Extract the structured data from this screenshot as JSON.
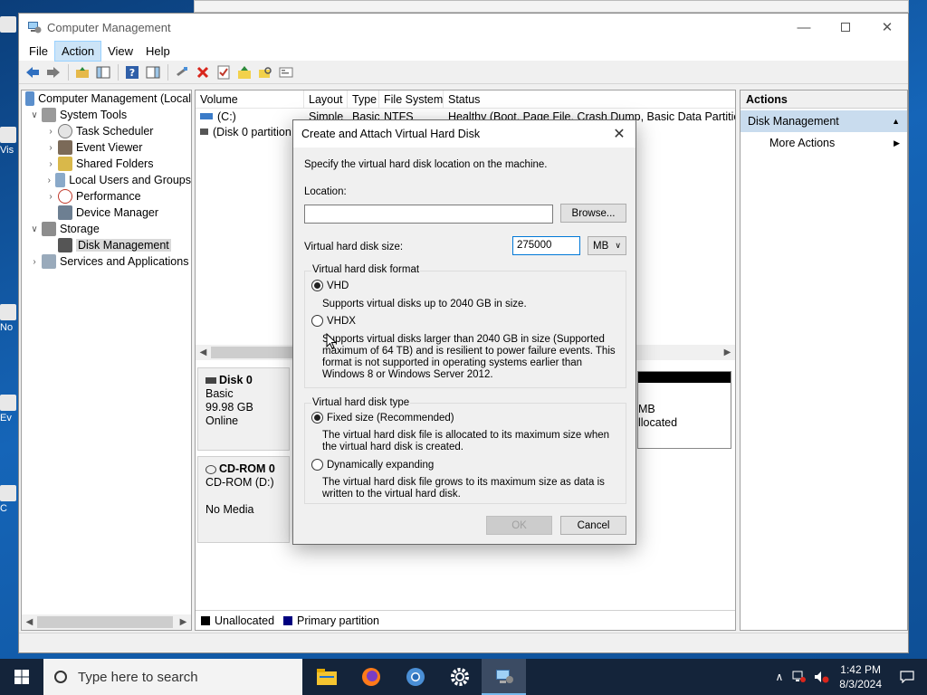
{
  "desktop": {
    "icon_labels": [
      "Vis",
      "No",
      "Ev",
      "C"
    ]
  },
  "window": {
    "title": "Computer Management",
    "menus": [
      "File",
      "Action",
      "View",
      "Help"
    ],
    "active_menu": "Action"
  },
  "tree": {
    "root": "Computer Management (Local",
    "items": {
      "system_tools": "System Tools",
      "task_scheduler": "Task Scheduler",
      "event_viewer": "Event Viewer",
      "shared_folders": "Shared Folders",
      "local_users": "Local Users and Groups",
      "performance": "Performance",
      "device_manager": "Device Manager",
      "storage": "Storage",
      "disk_management": "Disk Management",
      "services_apps": "Services and Applications"
    }
  },
  "volume_list": {
    "columns": [
      "Volume",
      "Layout",
      "Type",
      "File System",
      "Status"
    ],
    "rows": [
      {
        "volume": "(C:)",
        "layout": "Simple",
        "type": "Basic",
        "fs": "NTFS",
        "status": "Healthy (Boot, Page File, Crash Dump, Basic Data Partition)"
      },
      {
        "volume": "(Disk 0 partition",
        "layout": "",
        "type": "",
        "fs": "",
        "status": ""
      }
    ]
  },
  "disks": {
    "disk0": {
      "name": "Disk 0",
      "type": "Basic",
      "size": "99.98 GB",
      "state": "Online",
      "partial_right_1": "MB",
      "partial_right_2": "llocated"
    },
    "cdrom0": {
      "name": "CD-ROM 0",
      "type": "CD-ROM (D:)",
      "media": "No Media"
    }
  },
  "legend": {
    "unallocated": "Unallocated",
    "primary": "Primary partition",
    "unallocated_color": "#000000",
    "primary_color": "#00007f"
  },
  "actions": {
    "header": "Actions",
    "section": "Disk Management",
    "more": "More Actions"
  },
  "dialog": {
    "title": "Create and Attach Virtual Hard Disk",
    "instruction": "Specify the virtual hard disk location on the machine.",
    "location_label": "Location:",
    "location_value": "",
    "browse": "Browse...",
    "size_label": "Virtual hard disk size:",
    "size_value": "275000",
    "size_unit": "MB",
    "format_group": "Virtual hard disk format",
    "vhd": "VHD",
    "vhd_desc": "Supports virtual disks up to 2040 GB in size.",
    "vhdx": "VHDX",
    "vhdx_desc": "Supports virtual disks larger than 2040 GB in size (Supported maximum of 64 TB) and is resilient to power failure events. This format is not supported in operating systems earlier than Windows 8 or Windows Server 2012.",
    "type_group": "Virtual hard disk type",
    "fixed": "Fixed size (Recommended)",
    "fixed_desc": "The virtual hard disk file is allocated to its maximum size when the virtual hard disk is created.",
    "dynamic": "Dynamically expanding",
    "dynamic_desc": "The virtual hard disk file grows to its maximum size as data is written to the virtual hard disk.",
    "ok": "OK",
    "cancel": "Cancel"
  },
  "taskbar": {
    "search_placeholder": "Type here to search",
    "time": "1:42 PM",
    "date": "8/3/2024"
  }
}
